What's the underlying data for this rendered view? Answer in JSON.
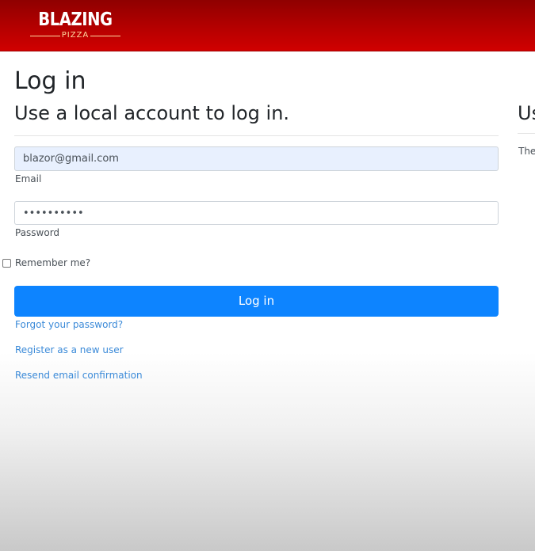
{
  "header": {
    "logo_main": "BLAZING",
    "logo_sub": "PIZZA",
    "brand_color": "#b50000"
  },
  "main": {
    "title": "Log in",
    "subtitle": "Use a local account to log in.",
    "email_value": "blazor@gmail.com",
    "email_label": "Email",
    "password_value": "••••••••••",
    "password_label": "Password",
    "remember_label": "Remember me?",
    "remember_checked": false,
    "login_button_label": "Log in",
    "login_button_color": "#0d84ff",
    "links": {
      "forgot": "Forgot your password?",
      "register": "Register as a new user",
      "resend": "Resend email confirmation"
    },
    "link_color": "#3b8ad8"
  },
  "right_panel": {
    "heading": "Us",
    "text": "The"
  }
}
